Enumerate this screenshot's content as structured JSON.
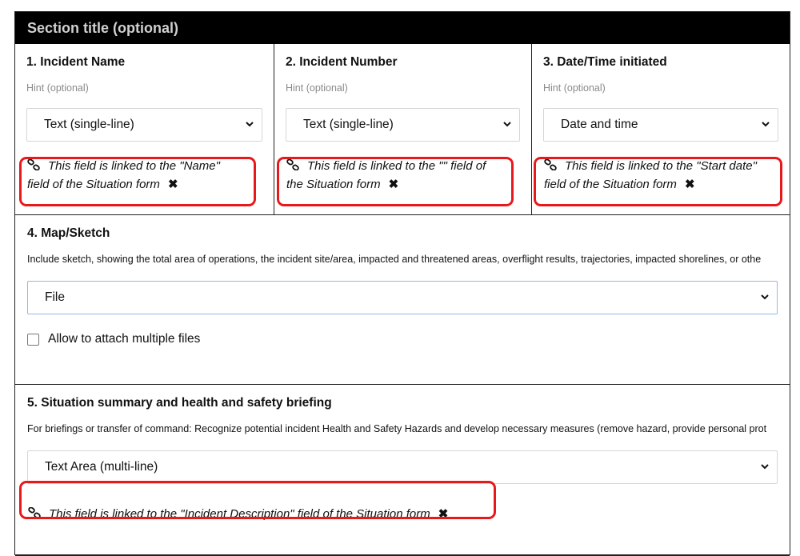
{
  "section": {
    "title": "Section title (optional)"
  },
  "fields": [
    {
      "title": "1. Incident Name",
      "hint": "Hint (optional)",
      "type": "Text (single-line)",
      "link_line1": "This field is linked to the \"Name\"",
      "link_line2": "field of the Situation form"
    },
    {
      "title": "2. Incident Number",
      "hint": "Hint (optional)",
      "type": "Text (single-line)",
      "link_line1": "This field is linked to the \"\" field of",
      "link_line2": "the Situation form"
    },
    {
      "title": "3. Date/Time initiated",
      "hint": "Hint (optional)",
      "type": "Date and time",
      "link_line1": "This field is linked to the \"Start date\"",
      "link_line2": "field of the Situation form"
    }
  ],
  "map": {
    "title": "4. Map/Sketch",
    "description": "Include sketch, showing the total area of operations, the incident site/area, impacted and threatened areas, overflight results, trajectories, impacted shorelines, or othe",
    "type": "File",
    "checkbox_label": "Allow to attach multiple files",
    "checkbox_checked": false
  },
  "situation": {
    "title": "5. Situation summary and health and safety briefing",
    "description": "For briefings or transfer of command: Recognize potential incident Health and Safety Hazards and develop necessary measures (remove hazard, provide personal prot",
    "type": "Text Area (multi-line)",
    "link_text": "This field is linked to the \"Incident Description\" field of the Situation form"
  },
  "colors": {
    "highlight": "#e8191b",
    "header_bg": "#000000",
    "header_text": "#d0d0d0",
    "focus_border": "#8fb8e8"
  },
  "icons": {
    "link": "link-icon",
    "remove": "close-icon",
    "dropdown": "chevron-down-icon"
  }
}
